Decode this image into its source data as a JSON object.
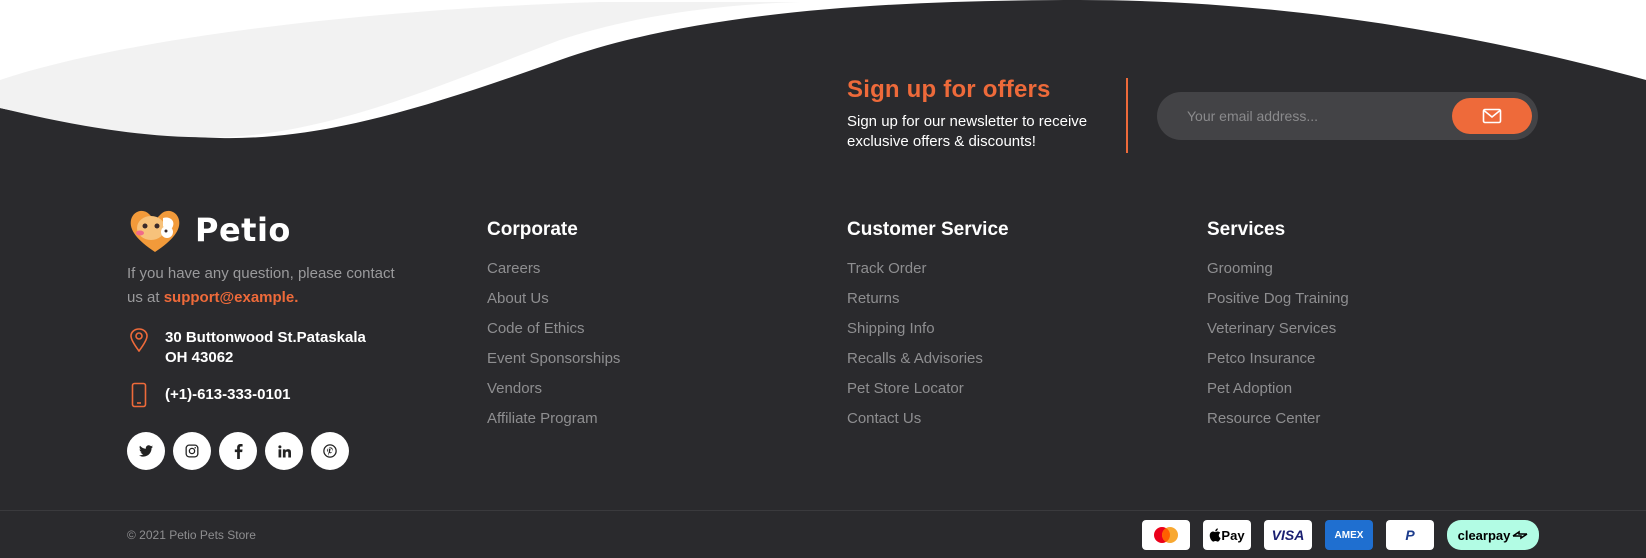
{
  "newsletter": {
    "title": "Sign up for offers",
    "text": "Sign up for our newsletter to receive exclusive offers & discounts!",
    "email_placeholder": "Your email address..."
  },
  "brand": {
    "name": "Petio",
    "description": "If you have any question, please contact us at",
    "email": "support@example.",
    "address_line1": "30 Buttonwood St.Pataskala",
    "address_line2": "OH 43062",
    "phone": "(+1)-613-333-0101",
    "socials": [
      "twitter-icon",
      "instagram-icon",
      "facebook-icon",
      "linkedin-icon",
      "pinterest-icon"
    ]
  },
  "columns": [
    {
      "title": "Corporate",
      "links": [
        "Careers",
        "About Us",
        "Code of Ethics",
        "Event Sponsorships",
        "Vendors",
        "Affiliate Program"
      ]
    },
    {
      "title": "Customer Service",
      "links": [
        "Track Order",
        "Returns",
        "Shipping Info",
        "Recalls & Advisories",
        "Pet Store Locator",
        "Contact Us"
      ]
    },
    {
      "title": "Services",
      "links": [
        "Grooming",
        "Positive Dog Training",
        "Veterinary Services",
        "Petco Insurance",
        "Pet Adoption",
        "Resource Center"
      ]
    }
  ],
  "bottom": {
    "copyright": "© 2021 Petio Pets Store",
    "payments": {
      "applepay": "Pay",
      "visa": "VISA",
      "amex": "AMEX",
      "paypal": "P",
      "clearpay": "clearpay"
    }
  },
  "colors": {
    "background": "#2a2a2d",
    "accent": "#ee6a3a",
    "wave_light": "#f2f2f2"
  }
}
